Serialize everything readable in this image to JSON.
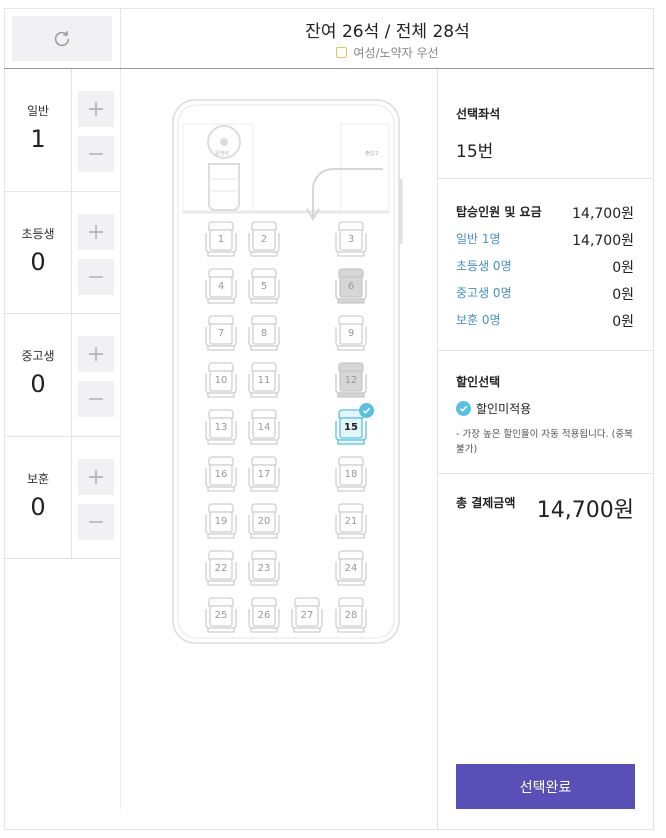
{
  "header": {
    "title": "잔여 26석 / 전체 28석",
    "subtitle": "여성/노약자 우선",
    "refresh_icon": "refresh-icon"
  },
  "passengers": [
    {
      "name": "일반",
      "count": "1"
    },
    {
      "name": "초등생",
      "count": "0"
    },
    {
      "name": "중고생",
      "count": "0"
    },
    {
      "name": "보훈",
      "count": "0"
    }
  ],
  "bus": {
    "driver_label": "운전석",
    "door_label": "출입구",
    "seats": [
      {
        "num": "1",
        "state": "free"
      },
      {
        "num": "2",
        "state": "free"
      },
      {
        "num": "3",
        "state": "free"
      },
      {
        "num": "4",
        "state": "free"
      },
      {
        "num": "5",
        "state": "free"
      },
      {
        "num": "6",
        "state": "taken"
      },
      {
        "num": "7",
        "state": "free"
      },
      {
        "num": "8",
        "state": "free"
      },
      {
        "num": "9",
        "state": "free"
      },
      {
        "num": "10",
        "state": "free"
      },
      {
        "num": "11",
        "state": "free"
      },
      {
        "num": "12",
        "state": "taken"
      },
      {
        "num": "13",
        "state": "free"
      },
      {
        "num": "14",
        "state": "free"
      },
      {
        "num": "15",
        "state": "selected"
      },
      {
        "num": "16",
        "state": "free"
      },
      {
        "num": "17",
        "state": "free"
      },
      {
        "num": "18",
        "state": "free"
      },
      {
        "num": "19",
        "state": "free"
      },
      {
        "num": "20",
        "state": "free"
      },
      {
        "num": "21",
        "state": "free"
      },
      {
        "num": "22",
        "state": "free"
      },
      {
        "num": "23",
        "state": "free"
      },
      {
        "num": "24",
        "state": "free"
      },
      {
        "num": "25",
        "state": "free"
      },
      {
        "num": "26",
        "state": "free"
      },
      {
        "num": "27",
        "state": "free"
      },
      {
        "num": "28",
        "state": "free"
      }
    ]
  },
  "summary": {
    "selected_title": "선택좌석",
    "selected_value": "15번",
    "fare_title": "탑승인원 및 요금",
    "fare_total": "14,700원",
    "fares": [
      {
        "label": "일반 1명",
        "value": "14,700원"
      },
      {
        "label": "초등생 0명",
        "value": "0원"
      },
      {
        "label": "중고생 0명",
        "value": "0원"
      },
      {
        "label": "보훈 0명",
        "value": "0원"
      }
    ],
    "discount_title": "할인선택",
    "discount_option": "할인미적용",
    "discount_note": "- 가장 높은 할인율이 자동 적용됩니다. (중복불가)",
    "total_title": "총 결제금액",
    "total_value": "14,700원"
  },
  "confirm_label": "선택완료",
  "colors": {
    "accent": "#5a4fb6",
    "selected_seat": "#5bc0e0",
    "taken_seat": "#d6d6d6",
    "fare_label": "#4a90c0"
  }
}
